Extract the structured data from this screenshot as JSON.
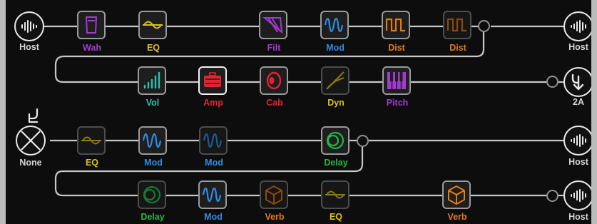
{
  "colors": {
    "background": "#0d0d0e",
    "frame": "#b9bcbb",
    "wire": "#c8c8c8",
    "node_text": "#d6d6d6",
    "purple": "#a33ad0",
    "yellow": "#d9c21c",
    "blue": "#2f8ce6",
    "orange": "#e27b12",
    "teal": "#29c2b0",
    "red": "#e02531",
    "green": "#23b547"
  },
  "paths": [
    {
      "input": {
        "label": "Host",
        "icon": "waveform-icon"
      },
      "output": {
        "label": "Host",
        "icon": "waveform-icon"
      },
      "blocks": [
        {
          "label": "Wah",
          "icon": "wah-pedal-icon",
          "color": "#a33ad0",
          "bypassed": false
        },
        {
          "label": "EQ",
          "icon": "eq-wave-icon",
          "color": "#d9c21c",
          "bypassed": false
        },
        {
          "label": "Filt",
          "icon": "filter-icon",
          "color": "#a33ad0",
          "bypassed": false
        },
        {
          "label": "Mod",
          "icon": "mod-wave-icon",
          "color": "#2f8ce6",
          "bypassed": false
        },
        {
          "label": "Dist",
          "icon": "dist-square-icon",
          "color": "#e27b12",
          "bypassed": false
        },
        {
          "label": "Dist",
          "icon": "dist-square-icon",
          "color": "#e27b12",
          "bypassed": true
        }
      ]
    },
    {
      "output": {
        "label": "2A",
        "icon": "path-split-arrow-icon"
      },
      "blocks": [
        {
          "label": "Vol",
          "icon": "volume-bars-icon",
          "color": "#29c2b0",
          "bypassed": false
        },
        {
          "label": "Amp",
          "icon": "amp-head-icon",
          "color": "#e02531",
          "bypassed": false,
          "selected": true
        },
        {
          "label": "Cab",
          "icon": "cab-speaker-icon",
          "color": "#e02531",
          "bypassed": false
        },
        {
          "label": "Dyn",
          "icon": "dyn-slope-icon",
          "color": "#d9c21c",
          "bypassed": true
        },
        {
          "label": "Pitch",
          "icon": "pitch-keys-icon",
          "color": "#a33ad0",
          "bypassed": false
        }
      ]
    },
    {
      "input": {
        "label": "None",
        "icon": "none-x-icon"
      },
      "output": {
        "label": "Host",
        "icon": "waveform-icon"
      },
      "blocks": [
        {
          "label": "EQ",
          "icon": "eq-wave-icon",
          "color": "#d9c21c",
          "bypassed": true
        },
        {
          "label": "Mod",
          "icon": "mod-wave-icon",
          "color": "#2f8ce6",
          "bypassed": false
        },
        {
          "label": "Mod",
          "icon": "mod-wave-icon",
          "color": "#2f8ce6",
          "bypassed": true
        },
        {
          "label": "Delay",
          "icon": "delay-rings-icon",
          "color": "#23b547",
          "bypassed": false
        }
      ]
    },
    {
      "output": {
        "label": "Host",
        "icon": "waveform-icon"
      },
      "blocks": [
        {
          "label": "Delay",
          "icon": "delay-rings-icon",
          "color": "#23b547",
          "bypassed": true
        },
        {
          "label": "Mod",
          "icon": "mod-wave-icon",
          "color": "#2f8ce6",
          "bypassed": false
        },
        {
          "label": "Verb",
          "icon": "verb-cube-icon",
          "color": "#e27b12",
          "bypassed": true
        },
        {
          "label": "EQ",
          "icon": "eq-wave-icon",
          "color": "#d9c21c",
          "bypassed": true
        },
        {
          "label": "Verb",
          "icon": "verb-cube-icon",
          "color": "#e27b12",
          "bypassed": false
        }
      ]
    }
  ]
}
